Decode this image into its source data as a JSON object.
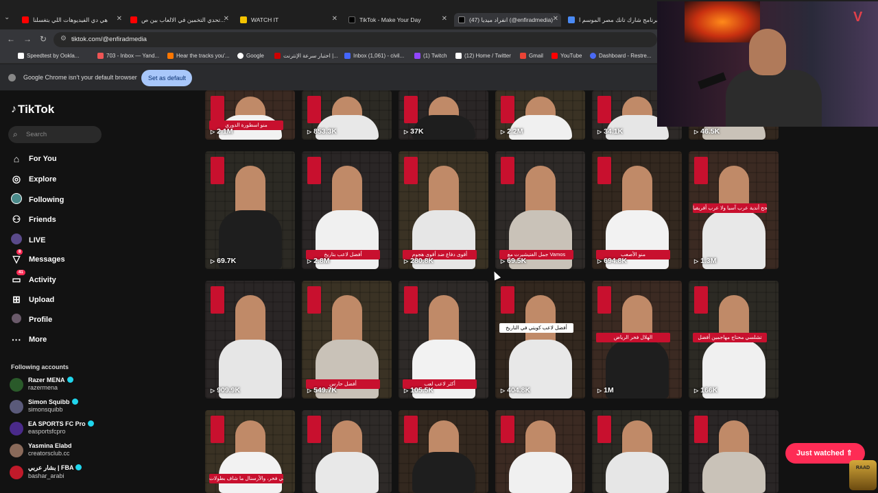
{
  "browser": {
    "tabs": [
      {
        "title": "هي دي الفيديوهات اللي بتغسلنا",
        "active": false
      },
      {
        "title": "تحدي التخمين في الالعاب بين ص...",
        "active": false
      },
      {
        "title": "WATCH IT",
        "active": false
      },
      {
        "title": "TikTok - Make Your Day",
        "active": false
      },
      {
        "title": "(47) انفراد ميديا (@enfiradmedia)",
        "active": true
      },
      {
        "title": "برنامج شارك تانك مصر الموسم ا...",
        "active": false
      }
    ],
    "url": "tiktok.com/@enfiradmedia",
    "bookmarks": [
      "Speedtest by Ookla...",
      "703 - Inbox — Yand...",
      "Hear the tracks you'...",
      "Google",
      "اختبار سرعة الإنترنت |...",
      "Inbox (1,061) - civil...",
      "(1) Twitch",
      "(12) Home / Twitter",
      "Gmail",
      "YouTube",
      "Dashboard - Restre..."
    ],
    "notice_text": "Google Chrome isn't your default browser",
    "set_default_label": "Set as default"
  },
  "sidebar": {
    "logo": "TikTok",
    "search_placeholder": "Search",
    "menu": [
      {
        "label": "For You",
        "icon": "home-icon"
      },
      {
        "label": "Explore",
        "icon": "compass-icon"
      },
      {
        "label": "Following",
        "icon": "following-avatar-icon"
      },
      {
        "label": "Friends",
        "icon": "friends-icon"
      },
      {
        "label": "LIVE",
        "icon": "live-icon"
      },
      {
        "label": "Messages",
        "icon": "messages-icon",
        "badge": "8"
      },
      {
        "label": "Activity",
        "icon": "activity-icon",
        "badge": "41"
      },
      {
        "label": "Upload",
        "icon": "upload-icon"
      },
      {
        "label": "Profile",
        "icon": "profile-icon"
      },
      {
        "label": "More",
        "icon": "more-icon"
      }
    ],
    "following_title": "Following accounts",
    "accounts": [
      {
        "name": "Razer MENA",
        "handle": "razermena",
        "verified": true,
        "color": "#2a5a2a"
      },
      {
        "name": "Simon Squibb",
        "handle": "simonsquibb",
        "verified": true,
        "color": "#5a5a7a"
      },
      {
        "name": "EA SPORTS FC Pro",
        "handle": "easportsfcpro",
        "verified": true,
        "color": "#4a2a8a"
      },
      {
        "name": "Yasmina Elabd",
        "handle": "creatorsclub.cc",
        "verified": false,
        "color": "#8a6a5a"
      },
      {
        "name": "بشار عربي | FBA",
        "handle": "bashar_arabi",
        "verified": true,
        "color": "#c01a2a"
      }
    ]
  },
  "videos": {
    "row1": [
      "2.1M",
      "853.3K",
      "37K",
      "2.2M",
      "34.1K",
      "46.5K"
    ],
    "row2": [
      "69.7K",
      "2.8M",
      "280.8K",
      "69.5K",
      "694.8K",
      "1.3M"
    ],
    "row3": [
      "909.9K",
      "549.7K",
      "105.5K",
      "404.8K",
      "1M",
      "166K"
    ],
    "row1_captions": [
      "منو اسطورة الدوري",
      "",
      "",
      "",
      "",
      ""
    ],
    "row2_captions": [
      "",
      "أفضل لاعب بتاريخ",
      "أقوى دفاع ضد أقوى هجوم",
      "جمل الفتيشيرت مع Vamos",
      "منو الأصعب",
      "منو الأنجح أندية عرب آسيا ولا عرب أفريقيا"
    ],
    "row3_captions": [
      "",
      "أفضل حارس",
      "أكثر لاعب لعب",
      "أفضل لاعب كويتي في التاريخ",
      "الهلال فخر الرياض",
      "تشلسي محتاج مهاجمين أفضل"
    ],
    "row4_captions": [
      "تشلسي فخر، والأرسنال ما شاف بطولات",
      "",
      "",
      "",
      "",
      ""
    ]
  },
  "just_watched_label": "Just watched",
  "watermark": "RAAD"
}
